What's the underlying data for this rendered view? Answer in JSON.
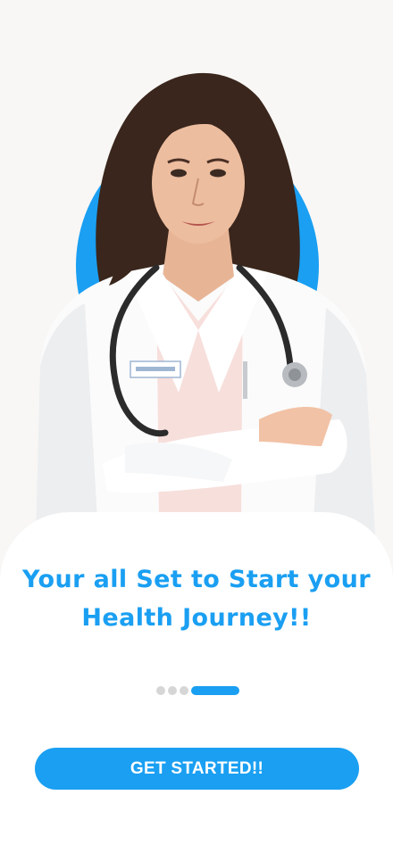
{
  "onboarding": {
    "headline": "Your all Set to Start your Health Journey!!",
    "pager": {
      "total": 4,
      "current": 4
    },
    "cta_label": "GET STARTED!!",
    "hero_image": "doctor-portrait"
  },
  "colors": {
    "accent": "#1a9ff2",
    "background": "#f8f7f5",
    "sheet": "#ffffff",
    "dot_inactive": "#d6d6d6"
  }
}
